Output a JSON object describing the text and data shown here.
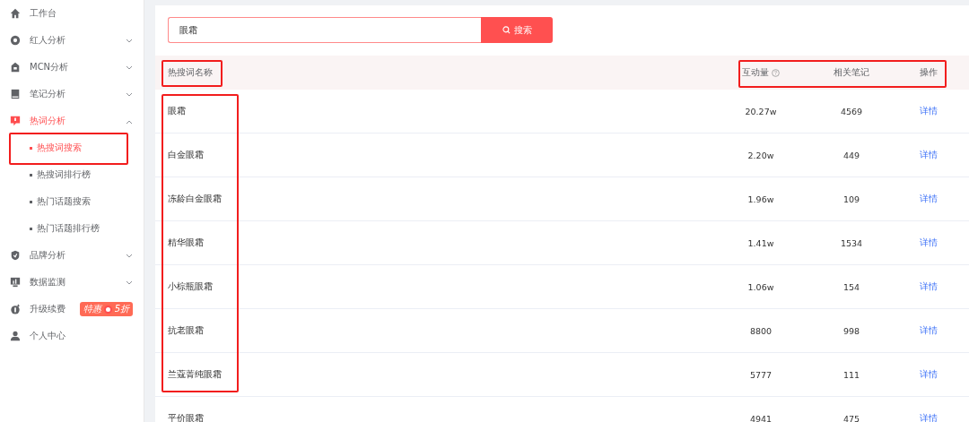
{
  "sidebar": {
    "items": [
      {
        "label": "工作台",
        "kind": "plain",
        "active": false
      },
      {
        "label": "红人分析",
        "kind": "group",
        "expanded": false,
        "active": false
      },
      {
        "label": "MCN分析",
        "kind": "group",
        "expanded": false,
        "active": false
      },
      {
        "label": "笔记分析",
        "kind": "group",
        "expanded": false,
        "active": false
      },
      {
        "label": "热词分析",
        "kind": "group",
        "expanded": true,
        "active": true,
        "children": [
          {
            "label": "热搜词搜索",
            "selected": true
          },
          {
            "label": "热搜词排行榜",
            "selected": false
          },
          {
            "label": "热门话题搜索",
            "selected": false
          },
          {
            "label": "热门话题排行榜",
            "selected": false
          }
        ]
      },
      {
        "label": "品牌分析",
        "kind": "group",
        "expanded": false,
        "active": false
      },
      {
        "label": "数据监测",
        "kind": "group",
        "expanded": false,
        "active": false
      },
      {
        "label": "升级续费",
        "kind": "badge",
        "badge": [
          "特惠",
          "5折"
        ],
        "active": false
      },
      {
        "label": "个人中心",
        "kind": "plain",
        "active": false
      }
    ]
  },
  "search": {
    "value": "眼霜",
    "button": "搜索"
  },
  "table": {
    "columns": [
      "热搜词名称",
      "互动量",
      "相关笔记",
      "操作"
    ],
    "rows": [
      {
        "name": "眼霜",
        "interactions": "20.27w",
        "notes": "4569",
        "action": "详情"
      },
      {
        "name": "白金眼霜",
        "interactions": "2.20w",
        "notes": "449",
        "action": "详情"
      },
      {
        "name": "冻龄白金眼霜",
        "interactions": "1.96w",
        "notes": "109",
        "action": "详情"
      },
      {
        "name": "精华眼霜",
        "interactions": "1.41w",
        "notes": "1534",
        "action": "详情"
      },
      {
        "name": "小棕瓶眼霜",
        "interactions": "1.06w",
        "notes": "154",
        "action": "详情"
      },
      {
        "name": "抗老眼霜",
        "interactions": "8800",
        "notes": "998",
        "action": "详情"
      },
      {
        "name": "兰蔻菁纯眼霜",
        "interactions": "5777",
        "notes": "111",
        "action": "详情"
      },
      {
        "name": "平价眼霜",
        "interactions": "4941",
        "notes": "475",
        "action": "详情"
      }
    ]
  },
  "annotations": [
    {
      "kind": "sidebar-item"
    },
    {
      "kind": "name-header"
    },
    {
      "kind": "metric-headers"
    },
    {
      "kind": "name-column"
    }
  ]
}
